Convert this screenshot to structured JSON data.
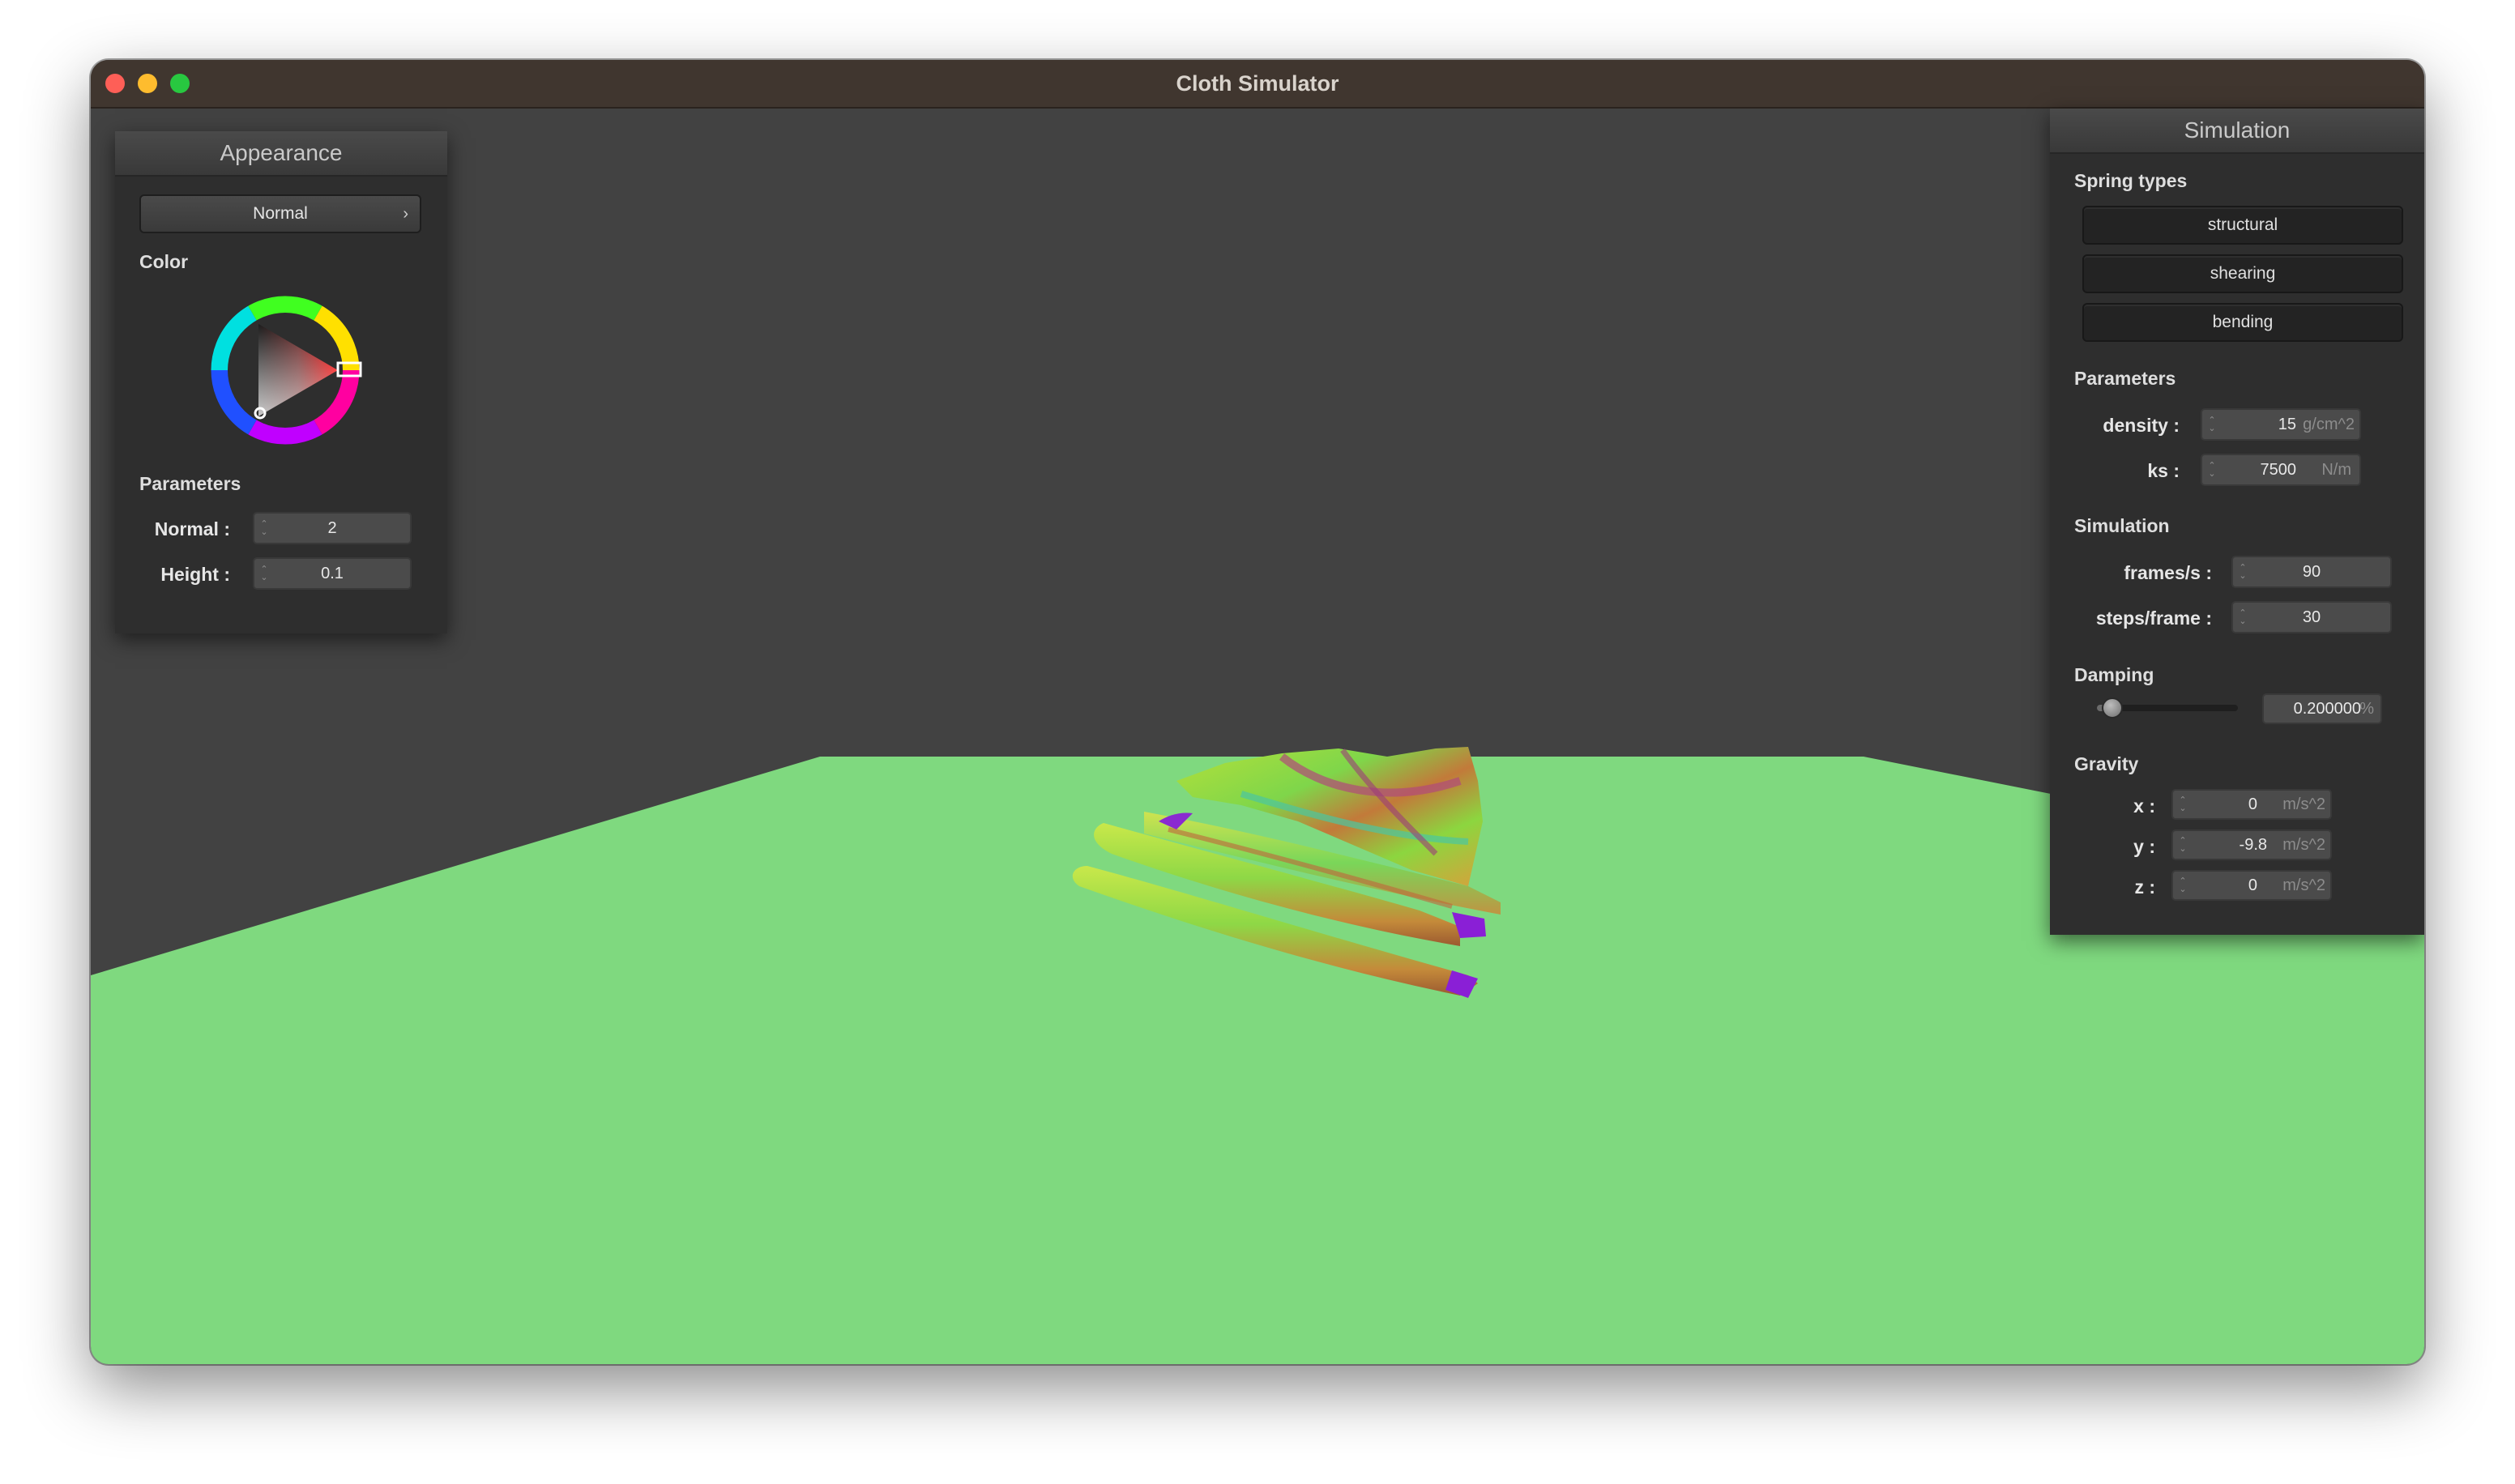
{
  "window": {
    "title": "Cloth Simulator"
  },
  "appearance": {
    "header": "Appearance",
    "shader_selected": "Normal",
    "color_section": "Color",
    "params_section": "Parameters",
    "normal_label": "Normal :",
    "normal_value": "2",
    "height_label": "Height :",
    "height_value": "0.1",
    "accent_color": "#ff0000"
  },
  "simulation_panel": {
    "header": "Simulation",
    "spring_section": "Spring types",
    "spring_buttons": [
      "structural",
      "shearing",
      "bending"
    ],
    "params_section": "Parameters",
    "density_label": "density :",
    "density_value": "15",
    "density_unit": "g/cm^2",
    "ks_label": "ks :",
    "ks_value": "7500",
    "ks_unit": "N/m",
    "sim_section": "Simulation",
    "fps_label": "frames/s :",
    "fps_value": "90",
    "steps_label": "steps/frame :",
    "steps_value": "30",
    "damping_section": "Damping",
    "damping_value": "0.200000",
    "damping_unit": "%",
    "damping_level": 0.2,
    "gravity_section": "Gravity",
    "gx_label": "x :",
    "gx_value": "0",
    "gy_label": "y :",
    "gy_value": "-9.8",
    "gz_label": "z :",
    "gz_value": "0",
    "gravity_unit": "m/s^2"
  },
  "colors": {
    "floor": "#7fd97f",
    "background": "#424242",
    "cloth_base": "#8fd63a"
  }
}
